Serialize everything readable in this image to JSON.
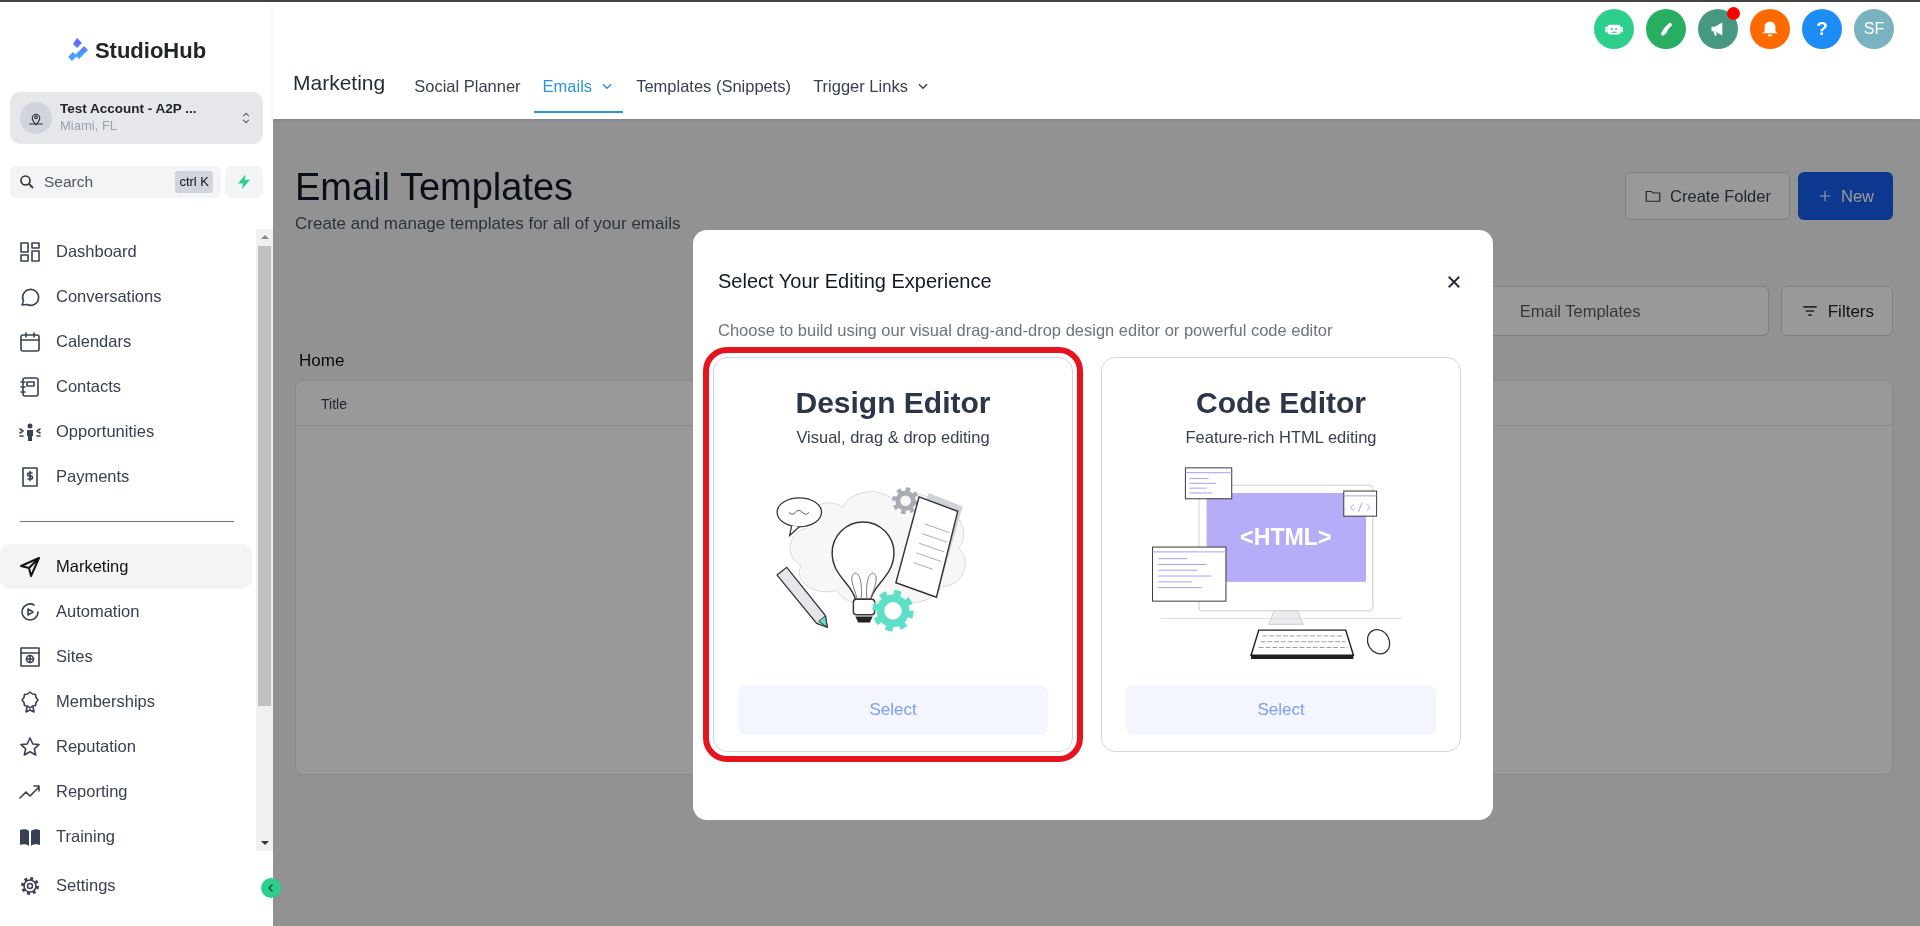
{
  "sidebar": {
    "logo": "StudioHub",
    "account": {
      "name": "Test Account - A2P ...",
      "location": "Miami, FL"
    },
    "search": {
      "placeholder": "Search",
      "shortcut": "ctrl K"
    },
    "items": [
      {
        "label": "Dashboard",
        "selected": false
      },
      {
        "label": "Conversations",
        "selected": false
      },
      {
        "label": "Calendars",
        "selected": false
      },
      {
        "label": "Contacts",
        "selected": false
      },
      {
        "label": "Opportunities",
        "selected": false
      },
      {
        "label": "Payments",
        "selected": false
      },
      {
        "label": "Marketing",
        "selected": true
      },
      {
        "label": "Automation",
        "selected": false
      },
      {
        "label": "Sites",
        "selected": false
      },
      {
        "label": "Memberships",
        "selected": false
      },
      {
        "label": "Reputation",
        "selected": false
      },
      {
        "label": "Reporting",
        "selected": false
      },
      {
        "label": "Training",
        "selected": false
      }
    ],
    "footer_item": {
      "label": "Settings",
      "selected": false
    }
  },
  "header": {
    "title": "Marketing",
    "tabs": [
      {
        "label": "Social Planner",
        "selected": false,
        "dropdown": false
      },
      {
        "label": "Emails",
        "selected": true,
        "dropdown": true
      },
      {
        "label": "Templates (Snippets)",
        "selected": false,
        "dropdown": false
      },
      {
        "label": "Trigger Links",
        "selected": false,
        "dropdown": true
      }
    ],
    "action_icons": [
      {
        "kind": "robot",
        "color": "#2ecf8c",
        "badge": false
      },
      {
        "kind": "phone",
        "color": "#27ae60",
        "badge": false
      },
      {
        "kind": "megaphone",
        "color": "#479882",
        "badge": true
      },
      {
        "kind": "bell",
        "color": "#ff6a00",
        "badge": false
      },
      {
        "kind": "help",
        "color": "#1e8cf5",
        "badge": false,
        "text": "?"
      },
      {
        "kind": "avatar",
        "color": "#79b3bf",
        "badge": false,
        "text": "SF"
      }
    ]
  },
  "page": {
    "title": "Email Templates",
    "subtitle": "Create and manage templates for all of your emails",
    "buttons": [
      {
        "label": "Create Folder",
        "kind": "outline"
      },
      {
        "label": "New",
        "kind": "primary"
      }
    ],
    "search": {
      "placeholder": "Email Templates"
    },
    "filters": "Filters",
    "breadcrumb": "Home",
    "table": {
      "columns": [
        "Title"
      ]
    }
  },
  "modal": {
    "title": "Select Your Editing Experience",
    "description": "Choose to build using our visual drag-and-drop design editor or powerful code editor",
    "options": [
      {
        "kind": "design",
        "title": "Design Editor",
        "subtitle": "Visual, drag & drop editing",
        "button": "Select",
        "selected": true
      },
      {
        "kind": "code",
        "title": "Code Editor",
        "subtitle": "Feature-rich HTML editing",
        "button": "Select",
        "selected": false,
        "screen_text": "<HTML>"
      }
    ]
  }
}
